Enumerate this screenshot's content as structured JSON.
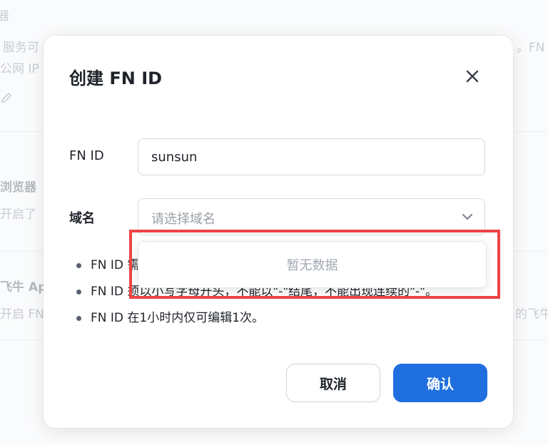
{
  "background": {
    "fragments": [
      "服务可",
      "公网 IP",
      "浏览器",
      "开启了",
      "飞牛 Ap",
      "开启 FN",
      "。FN",
      "的飞牛",
      "器"
    ]
  },
  "dialog": {
    "title": "创建 FN ID",
    "fn_id_label": "FN ID",
    "fn_id_value": "sunsun",
    "domain_label": "域名",
    "domain_placeholder": "请选择域名",
    "dropdown_empty": "暂无数据",
    "notes": [
      "FN ID 需",
      "FN ID 须以小写字母开头，不能以\"-\"结尾，不能出现连续的\"-\"。",
      "FN ID 在1小时内仅可编辑1次。"
    ],
    "cancel_label": "取消",
    "confirm_label": "确认"
  },
  "colors": {
    "primary": "#1f6fe0",
    "highlight": "#ef4444"
  }
}
